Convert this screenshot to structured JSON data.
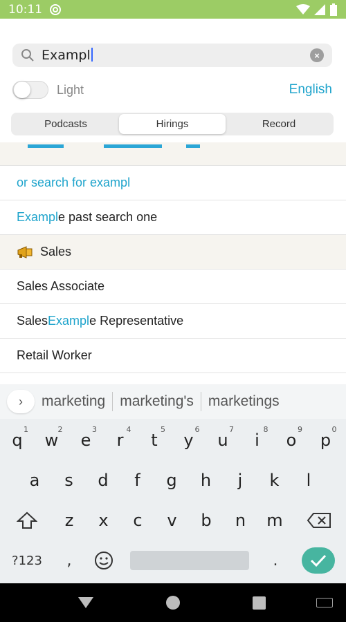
{
  "status_bar": {
    "time": "10:11"
  },
  "search": {
    "value": "Exampl"
  },
  "toggle": {
    "label": "Light",
    "on": false
  },
  "language": {
    "label": "English"
  },
  "tabs": [
    {
      "label": "Podcasts",
      "active": false
    },
    {
      "label": "Hirings",
      "active": true
    },
    {
      "label": "Record",
      "active": false
    }
  ],
  "list": {
    "search_for": "or search for exampl",
    "past_search": {
      "highlight": "Exampl",
      "rest": "e past search one"
    },
    "section": {
      "title": "Sales",
      "icon": "megaphone-icon"
    },
    "items": [
      {
        "text": "Sales Associate"
      },
      {
        "before": "Sales ",
        "highlight": "Exampl",
        "after": "e Representative"
      },
      {
        "text": "Retail Worker"
      }
    ]
  },
  "keyboard": {
    "suggestions": [
      "marketing",
      "marketing's",
      "marketings"
    ],
    "row1": [
      "q",
      "w",
      "e",
      "r",
      "t",
      "y",
      "u",
      "i",
      "o",
      "p"
    ],
    "row1_hints": [
      "1",
      "2",
      "3",
      "4",
      "5",
      "6",
      "7",
      "8",
      "9",
      "0"
    ],
    "row2": [
      "a",
      "s",
      "d",
      "f",
      "g",
      "h",
      "j",
      "k",
      "l"
    ],
    "row3": [
      "z",
      "x",
      "c",
      "v",
      "b",
      "n",
      "m"
    ],
    "symbols_key": "?123",
    "comma": ",",
    "period": "."
  },
  "colors": {
    "accent": "#1fa4cc",
    "status_bar": "#9ccc65",
    "enter_key": "#47b5a0"
  }
}
